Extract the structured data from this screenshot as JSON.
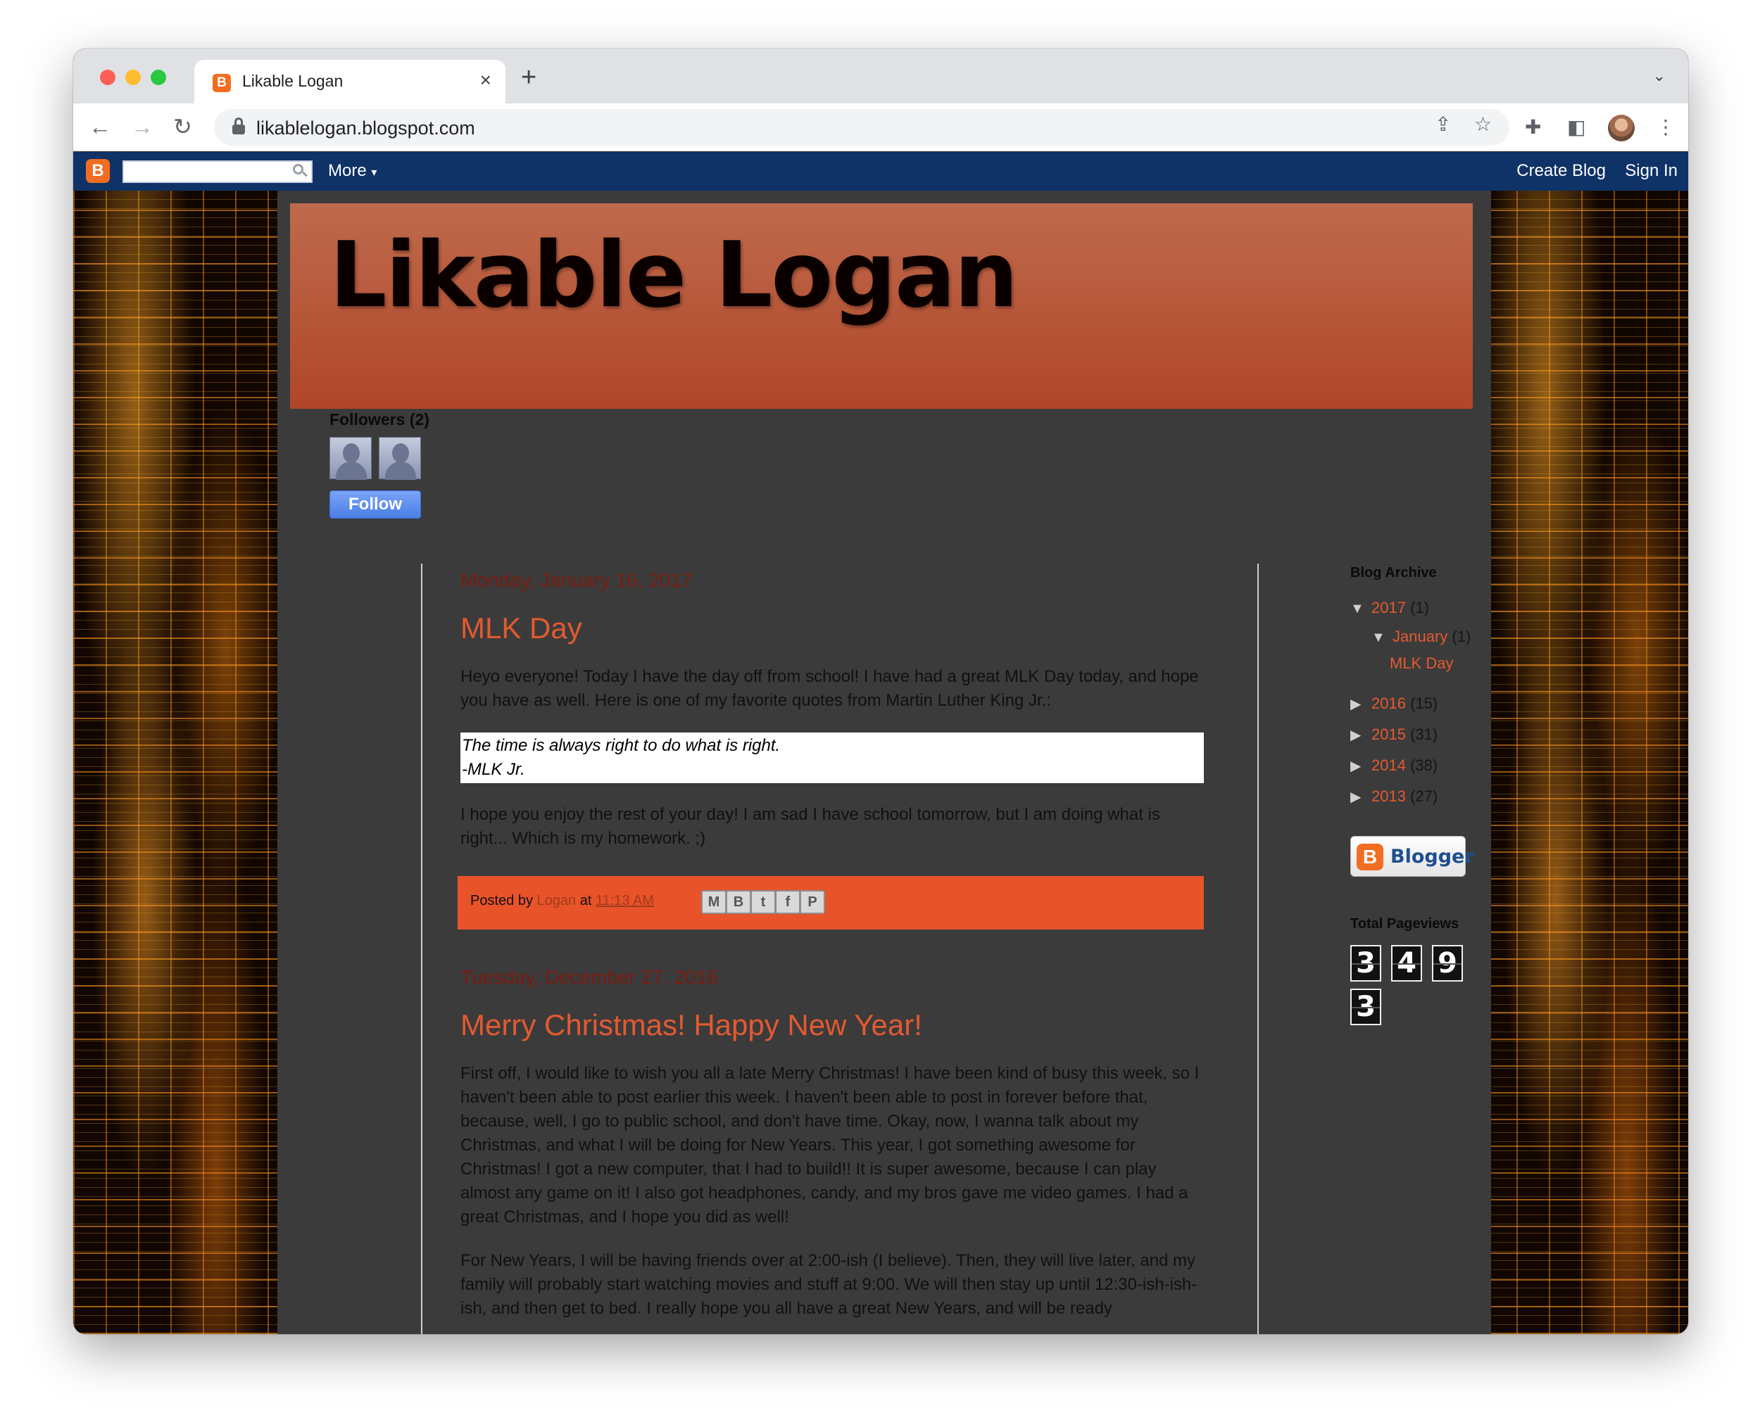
{
  "browser": {
    "tab_title": "Likable Logan",
    "url": "likablelogan.blogspot.com"
  },
  "navbar": {
    "more_label": "More",
    "create_blog": "Create Blog",
    "sign_in": "Sign In"
  },
  "blog": {
    "title": "Likable Logan"
  },
  "followers": {
    "title": "Followers (2)",
    "follow_label": "Follow"
  },
  "posts": [
    {
      "date": "Monday, January 16, 2017",
      "title": "MLK Day",
      "para1": "Heyo everyone!  Today I have the day off from school!  I have had a great MLK Day today, and hope you have as well.  Here is one of my favorite quotes from Martin Luther King Jr.:",
      "quote_line1": "The time is always right to do what is right.",
      "quote_line2": "-MLK Jr.",
      "para2": "I hope you enjoy the rest of your day!  I am sad I have school tomorrow, but I am doing what is right...  Which is my homework.  ;)",
      "posted_by": "Posted by",
      "author": "Logan",
      "at": "at",
      "time": "11:13 AM"
    },
    {
      "date": "Tuesday, December 27, 2016",
      "title": "Merry Christmas! Happy New Year!",
      "para1": "First off, I would like to wish you all a late Merry Christmas!  I have been kind of busy this week, so I haven't been able to post earlier this week.  I haven't been able to post in forever before that, because, well, I go to public school, and don't have time.  Okay, now, I wanna talk about my Christmas, and what I will be doing for New Years.  This year, I got something awesome for Christmas!  I got a new computer, that I had to build!!  It is super awesome, because I can play almost any game on it!  I also got headphones, candy, and my bros gave me video games.  I had a great Christmas, and I hope you did as well!",
      "para2": "For New Years, I will be having friends over at 2:00-ish (I believe).  Then, they will live later, and my family will probably start watching movies and stuff at 9:00.  We will then stay up until 12:30-ish-ish-ish, and then get to bed.  I really hope you all have a great New Years, and will be ready"
    }
  ],
  "archive": {
    "title": "Blog Archive",
    "years": [
      {
        "year": "2017",
        "count": "(1)",
        "expanded": true
      },
      {
        "year": "2016",
        "count": "(15)"
      },
      {
        "year": "2015",
        "count": "(31)"
      },
      {
        "year": "2014",
        "count": "(38)"
      },
      {
        "year": "2013",
        "count": "(27)"
      }
    ],
    "month": "January",
    "month_count": "(1)",
    "month_post": "MLK Day"
  },
  "blogger_badge": "Blogger",
  "pageviews": {
    "title": "Total Pageviews",
    "digits": [
      "3",
      "4",
      "9",
      "3"
    ]
  },
  "colors": {
    "accent": "#e35a30",
    "navbar": "#0f3267",
    "header": "#b04628"
  }
}
